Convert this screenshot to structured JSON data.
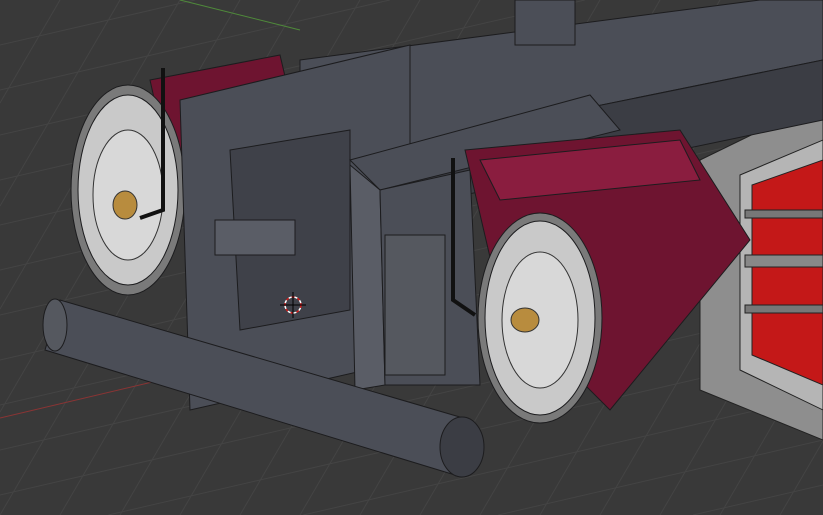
{
  "viewport": {
    "type": "3d-viewport",
    "shading": "solid-wireframe",
    "colors": {
      "background": "#393939",
      "grid": "#444444",
      "x_axis": "#8a3434",
      "y_axis": "#4f8a3a",
      "frame": "#4b4e57",
      "frame_dark": "#3b3d44",
      "wire": "#1c1c1e",
      "drum": "#6e1430",
      "drum_light": "#8a1d3f",
      "wheel_face": "#c9c9c9",
      "brass": "#b88c3e",
      "red_wheel": "#c41818",
      "cursor": "#d11a1a"
    }
  }
}
